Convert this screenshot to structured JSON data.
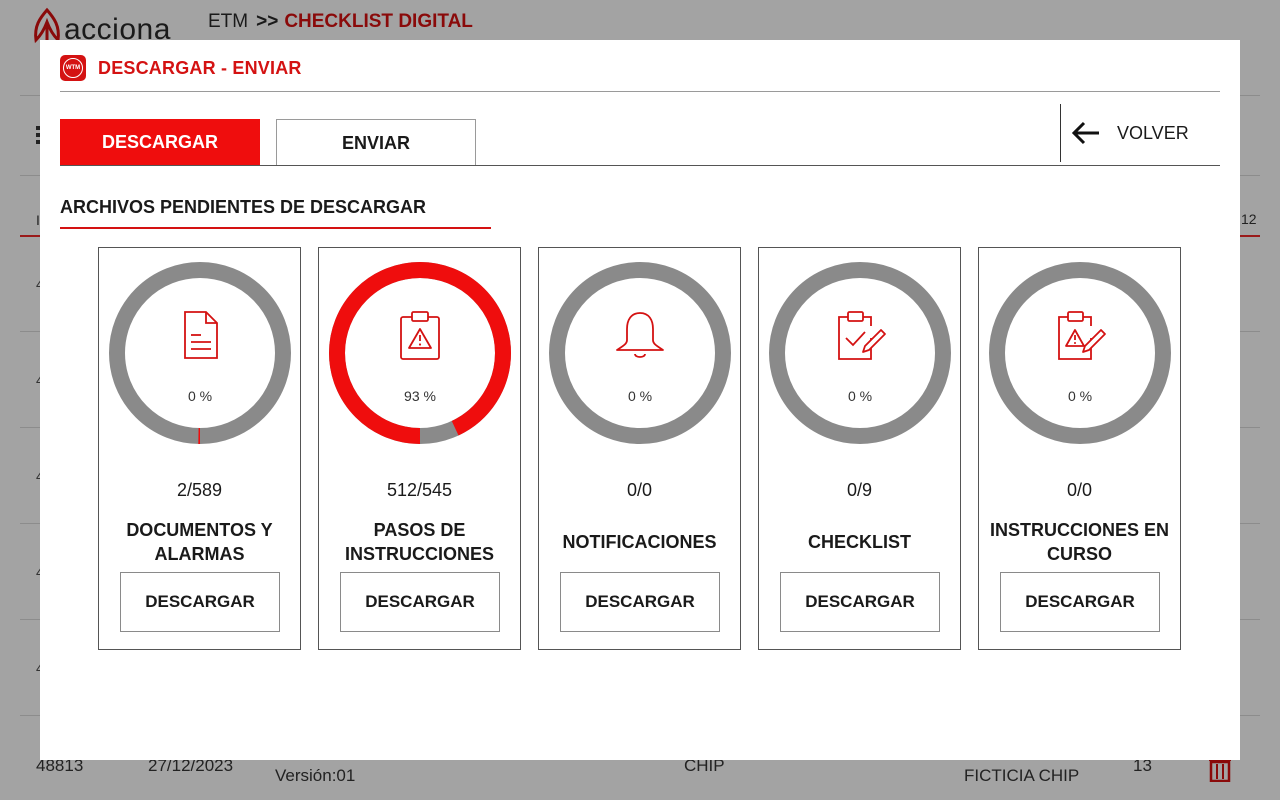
{
  "background": {
    "logo_text": "acciona",
    "breadcrumb": {
      "root": "ETM",
      "separator": ">>",
      "current": "CHECKLIST DIGITAL"
    },
    "column_label_left": "I",
    "column_label_right": "12",
    "row_digits": [
      "4",
      "4",
      "4",
      "4",
      "4"
    ],
    "bottom_row": {
      "id": "48813",
      "date": "27/12/2023",
      "version": "Versión:01",
      "col_chip": "CHIP",
      "col_ficticia": "FICTICIA CHIP",
      "number": "13"
    }
  },
  "modal": {
    "icon_text": "WTM",
    "title": "DESCARGAR - ENVIAR",
    "tabs": [
      {
        "label": "DESCARGAR",
        "active": true
      },
      {
        "label": "ENVIAR",
        "active": false
      }
    ],
    "back_label": "VOLVER",
    "section_title": "ARCHIVOS PENDIENTES DE DESCARGAR",
    "colors": {
      "accent": "#ef0d0d",
      "ring_grey": "#8a8a8a"
    },
    "cards": [
      {
        "icon": "document-icon",
        "percent_label": "0 %",
        "progress": 0.003,
        "count": "2/589",
        "name": "DOCUMENTOS Y ALARMAS",
        "button": "DESCARGAR"
      },
      {
        "icon": "clipboard-warning-icon",
        "percent_label": "93 %",
        "progress": 0.93,
        "count": "512/545",
        "name": "PASOS DE INSTRUCCIONES",
        "button": "DESCARGAR"
      },
      {
        "icon": "bell-icon",
        "percent_label": "0 %",
        "progress": 0,
        "count": "0/0",
        "name": "NOTIFICACIONES",
        "button": "DESCARGAR"
      },
      {
        "icon": "clipboard-check-icon",
        "percent_label": "0 %",
        "progress": 0,
        "count": "0/9",
        "name": "CHECKLIST",
        "button": "DESCARGAR"
      },
      {
        "icon": "clipboard-warning-edit-icon",
        "percent_label": "0 %",
        "progress": 0,
        "count": "0/0",
        "name": "INSTRUCCIONES EN CURSO",
        "button": "DESCARGAR"
      }
    ]
  }
}
